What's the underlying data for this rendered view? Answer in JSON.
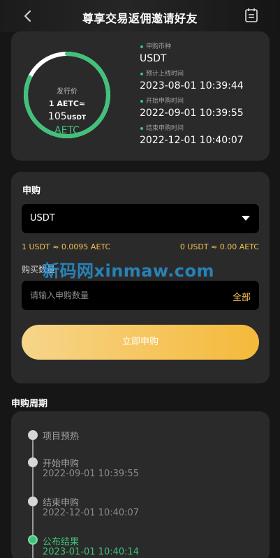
{
  "header": {
    "title": "尊享交易返佣邀请好友"
  },
  "colors": {
    "accent_green": "#41c27a",
    "accent_gold": "#f2c14e",
    "button_gradient_start": "#f6d58a",
    "button_gradient_end": "#f5b93a"
  },
  "issue": {
    "label": "发行价",
    "rate_line": "1 AETC≈",
    "price": "105",
    "price_unit": "USDT",
    "token": "AETC",
    "progress": 0.82
  },
  "info": [
    {
      "label": "申购币种",
      "value": "USDT"
    },
    {
      "label": "预计上线时间",
      "value": "2023-08-01 10:39:44"
    },
    {
      "label": "开始申购时间",
      "value": "2022-09-01 10:39:55"
    },
    {
      "label": "结束申购时间",
      "value": "2022-12-01 10:40:07"
    }
  ],
  "subscribe": {
    "section_label": "申购",
    "currency_value": "USDT",
    "rate_left": "1 USDT ≈ 0.0095 AETC",
    "rate_right": "0 USDT ≈ 0.00 AETC",
    "qty_label": "购买数量",
    "qty_placeholder": "请输入申购数量",
    "all_label": "全部",
    "submit_label": "立即申购",
    "watermark": "新码网xinmaw.com"
  },
  "timeline": {
    "title": "申购周期",
    "items": [
      {
        "name": "项目预热",
        "date": ""
      },
      {
        "name": "开始申购",
        "date": "2022-09-01 10:39:55"
      },
      {
        "name": "结束申购",
        "date": "2022-12-01 10:40:07"
      },
      {
        "name": "公布结果",
        "date": "2023-01-01 10:40:14"
      }
    ]
  }
}
